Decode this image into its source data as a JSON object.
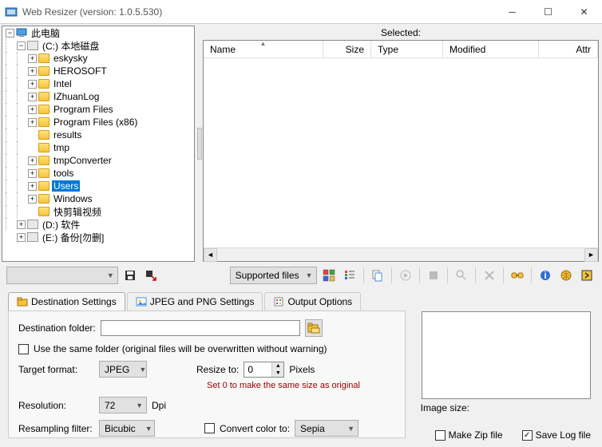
{
  "window": {
    "title": "Web Resizer (version: 1.0.5.530)"
  },
  "tree": {
    "root": "此电脑",
    "drive_c": "(C:) 本地磁盘",
    "folders": [
      "eskysky",
      "HEROSOFT",
      "Intel",
      "IZhuanLog",
      "Program Files",
      "Program Files (x86)",
      "results",
      "tmp",
      "tmpConverter",
      "tools",
      "Users",
      "Windows",
      "快剪辑视频"
    ],
    "selected": "Users",
    "drive_d": "(D:) 软件",
    "drive_e": "(E:) 备份[勿删]"
  },
  "rightpane": {
    "selected_label": "Selected:",
    "cols": {
      "name": "Name",
      "size": "Size",
      "type": "Type",
      "modified": "Modified",
      "attr": "Attr"
    }
  },
  "toolbar": {
    "blank_combo": "",
    "supported": "Supported files"
  },
  "tabs": {
    "dest": "Destination Settings",
    "jpeg": "JPEG and PNG Settings",
    "output": "Output Options"
  },
  "settings": {
    "dest_folder_label": "Destination folder:",
    "dest_folder_value": "",
    "same_folder": "Use the same folder (original files will be overwritten without warning)",
    "target_format_label": "Target format:",
    "target_format_value": "JPEG",
    "resize_label": "Resize to:",
    "resize_value": "0",
    "resize_unit": "Pixels",
    "resize_hint": "Set 0 to make the same size as original",
    "resolution_label": "Resolution:",
    "resolution_value": "72",
    "resolution_unit": "Dpi",
    "resample_label": "Resampling filter:",
    "resample_value": "Bicubic",
    "convert_label": "Convert color to:",
    "convert_value": "Sepia"
  },
  "preview": {
    "imgsize_label": "Image size:",
    "make_zip": "Make Zip file",
    "save_log": "Save Log file"
  }
}
